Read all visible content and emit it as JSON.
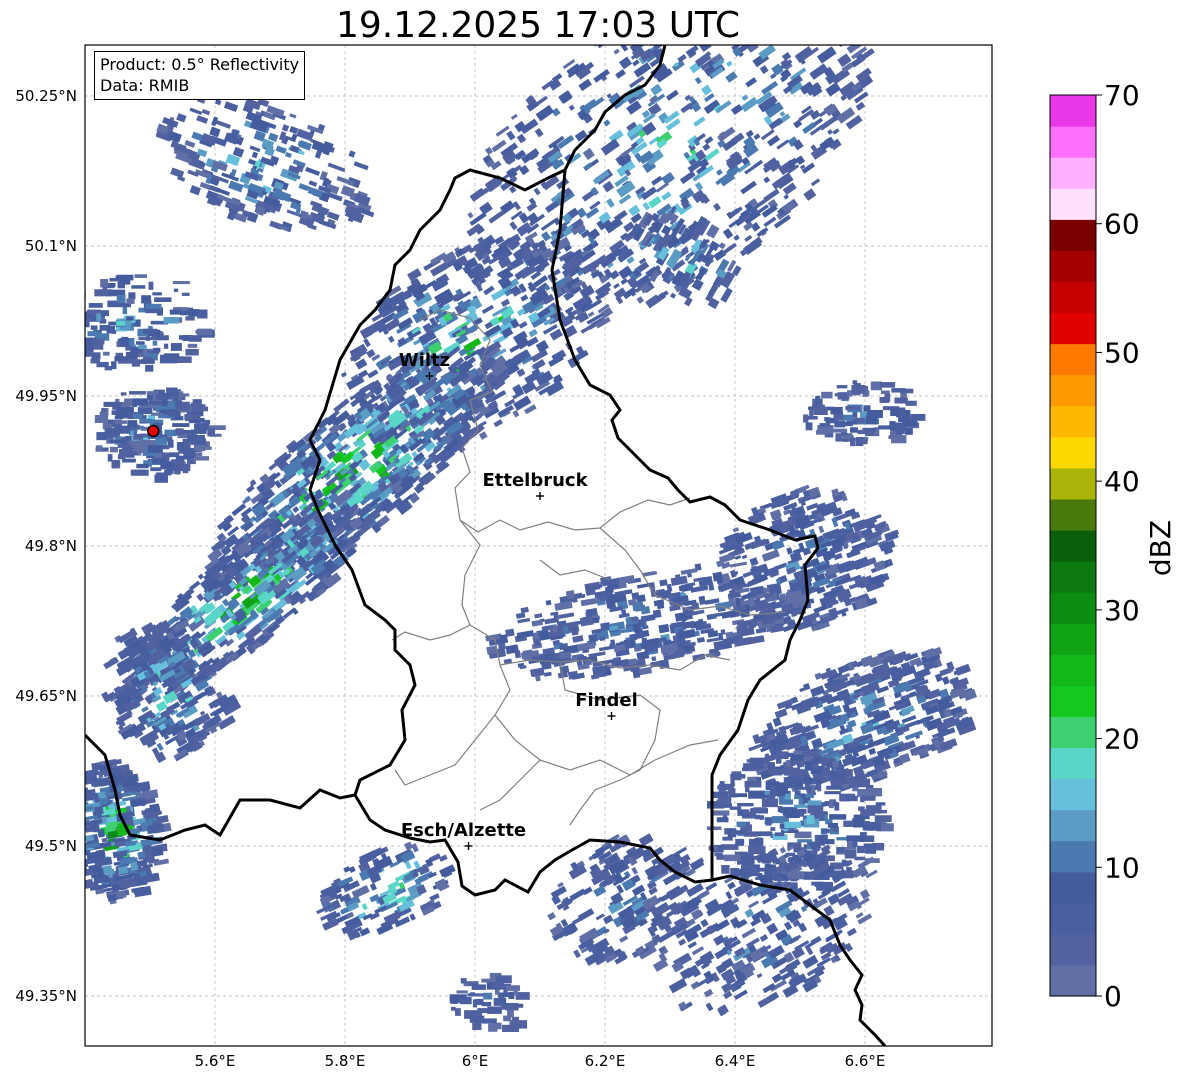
{
  "title": "19.12.2025 17:03 UTC",
  "info": {
    "product": "Product: 0.5° Reflectivity",
    "data_source": "Data: RMIB"
  },
  "map": {
    "lon_range": [
      5.4,
      6.8
    ],
    "lat_range": [
      49.3,
      50.3
    ],
    "x_ticks": [
      {
        "lon": 5.6,
        "label": "5.6°E"
      },
      {
        "lon": 5.8,
        "label": "5.8°E"
      },
      {
        "lon": 6.0,
        "label": "6°E"
      },
      {
        "lon": 6.2,
        "label": "6.2°E"
      },
      {
        "lon": 6.4,
        "label": "6.4°E"
      },
      {
        "lon": 6.6,
        "label": "6.6°E"
      }
    ],
    "y_ticks": [
      {
        "lat": 50.25,
        "label": "50.25°N"
      },
      {
        "lat": 50.1,
        "label": "50.1°N"
      },
      {
        "lat": 49.95,
        "label": "49.95°N"
      },
      {
        "lat": 49.8,
        "label": "49.8°N"
      },
      {
        "lat": 49.65,
        "label": "49.65°N"
      },
      {
        "lat": 49.5,
        "label": "49.5°N"
      },
      {
        "lat": 49.35,
        "label": "49.35°N"
      }
    ],
    "cities": [
      {
        "name": "Wiltz",
        "lon": 5.93,
        "lat": 49.97
      },
      {
        "name": "Ettelbruck",
        "lon": 6.1,
        "lat": 49.85
      },
      {
        "name": "Findel",
        "lon": 6.21,
        "lat": 49.63
      },
      {
        "name": "Esch/Alzette",
        "lon": 5.99,
        "lat": 49.5
      }
    ],
    "radar_site": {
      "lon": 5.505,
      "lat": 49.915
    },
    "grid": true,
    "colors": {
      "border": "#000000",
      "canton": "#808080",
      "site": "#e00000"
    }
  },
  "colorbar": {
    "label": "dBZ",
    "range": [
      0,
      70
    ],
    "ticks": [
      "0",
      "10",
      "20",
      "30",
      "40",
      "50",
      "60",
      "70"
    ],
    "colors": [
      "#6070a6",
      "#5262a0",
      "#4a5fa0",
      "#445c9e",
      "#4a7ab0",
      "#5a9cc4",
      "#66c0dc",
      "#5ad6c8",
      "#3cd070",
      "#14c820",
      "#14b818",
      "#10a414",
      "#0c8c10",
      "#0c7810",
      "#0a600a",
      "#4a7a0c",
      "#aab40a",
      "#ffd800",
      "#ffb800",
      "#ff9a00",
      "#ff7a00",
      "#e00000",
      "#c40000",
      "#a40000",
      "#7a0000",
      "#ffe0ff",
      "#ffb0ff",
      "#ff70ff",
      "#e838e8"
    ]
  },
  "echo_regions": [
    {
      "name": "nw-cells",
      "level": 4
    },
    {
      "name": "west-band",
      "level": 7
    },
    {
      "name": "north-band",
      "level": 5
    },
    {
      "name": "east-field",
      "level": 3
    },
    {
      "name": "south-field",
      "level": 3
    }
  ]
}
